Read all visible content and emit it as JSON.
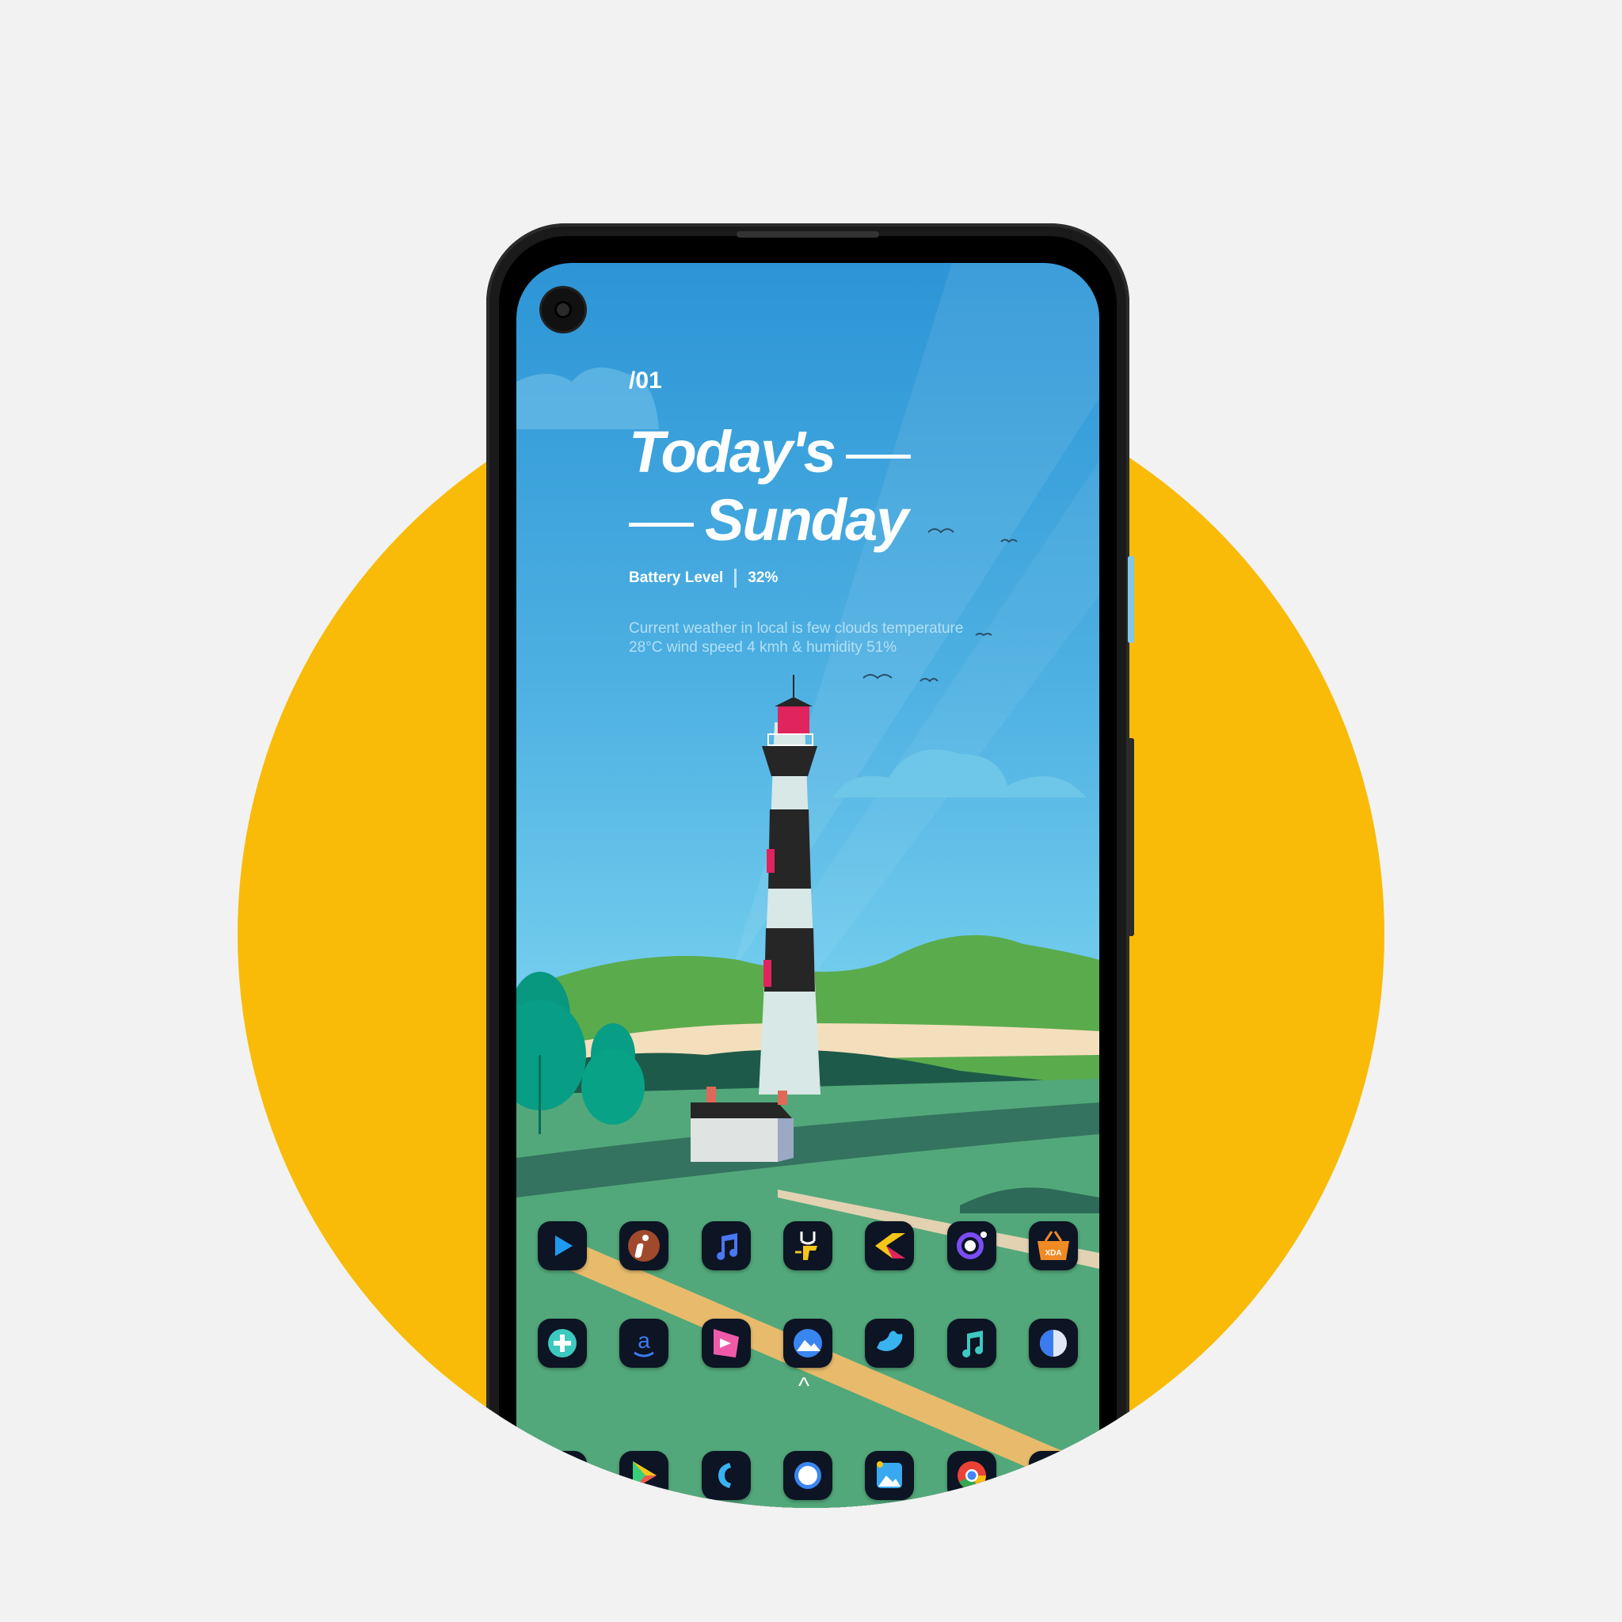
{
  "widget": {
    "page_index": "/01",
    "title_line1": "Today's",
    "title_line2": "Sunday",
    "battery_label": "Battery Level",
    "battery_value": "32%",
    "weather_text": "Current weather in local is few clouds temperature 28°C wind speed 4 kmh & humidity 51%"
  },
  "home": {
    "row1": [
      "Video Player",
      "Information",
      "Music",
      "Fitness",
      "Keep",
      "Camera",
      "XDA"
    ],
    "row1_badge": "XDA",
    "row2": [
      "Add",
      "Amazon",
      "Slides",
      "Gallery",
      "Twitter",
      "Music Player",
      "Pay"
    ],
    "row2_amazon_glyph": "a",
    "drawer_hint": "^",
    "dock": [
      "Store",
      "Play Store",
      "Phone",
      "Messages",
      "Photos",
      "Chrome",
      "WhatsApp"
    ]
  },
  "colors": {
    "background": "#f2f2f2",
    "circle": "#f9bb07",
    "phone": "#1a1a1a",
    "sky": "#2d95d6"
  }
}
